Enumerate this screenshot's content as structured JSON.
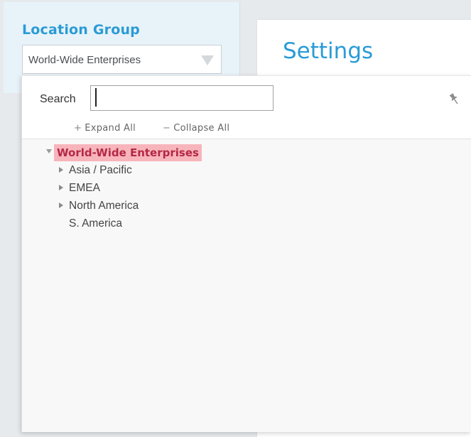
{
  "location_group": {
    "title": "Location Group",
    "selected": "World-Wide Enterprises"
  },
  "settings": {
    "title": "Settings"
  },
  "tree_panel": {
    "search_label": "Search",
    "search_value": "",
    "expand_all": "Expand All",
    "collapse_all": "Collapse All",
    "root": {
      "label": "World-Wide Enterprises",
      "expanded": true,
      "children": [
        {
          "label": "Asia / Pacific",
          "has_children": true
        },
        {
          "label": "EMEA",
          "has_children": true
        },
        {
          "label": "North America",
          "has_children": true
        },
        {
          "label": "S. America",
          "has_children": false
        }
      ]
    }
  },
  "icons": {
    "select_caret": "chevron-down-icon",
    "pin": "pin-icon",
    "expand": "plus-icon",
    "collapse": "minus-icon",
    "tree_expanded": "triangle-down-icon",
    "tree_collapsed": "triangle-right-icon"
  },
  "colors": {
    "accent": "#2a9bd6",
    "selected_bg": "#f7b5bb",
    "selected_text": "#b42846",
    "header_bg": "#e8f3f9"
  }
}
